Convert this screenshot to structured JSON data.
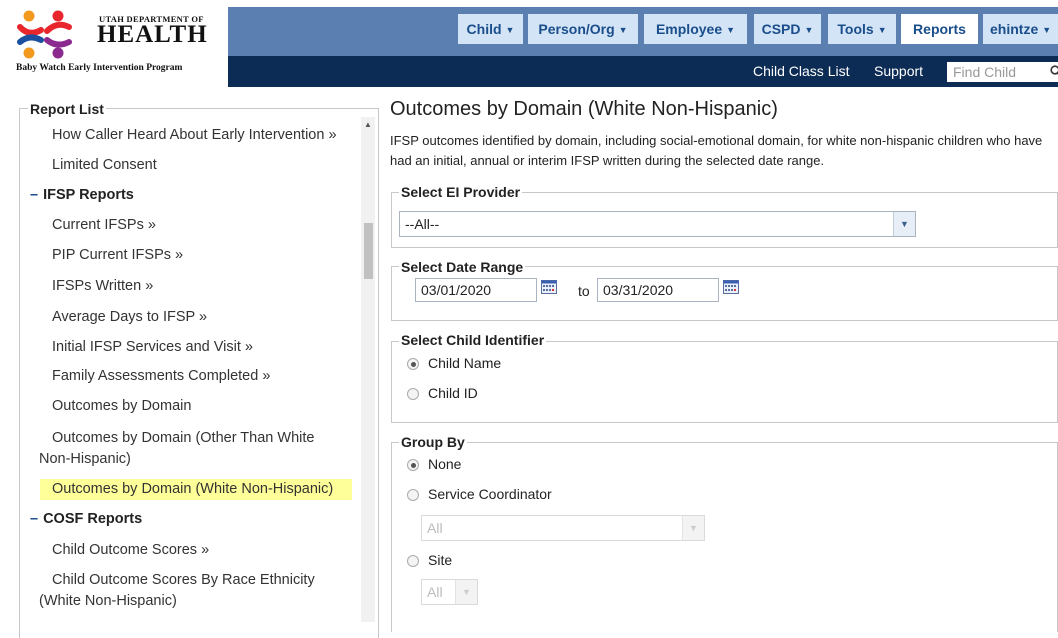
{
  "header": {
    "logo_small": "UTAH DEPARTMENT OF",
    "logo_big": "HEALTH",
    "program": "Baby Watch Early Intervention Program",
    "nav": [
      {
        "label": "Child",
        "has_menu": true
      },
      {
        "label": "Person/Org",
        "has_menu": true
      },
      {
        "label": "Employee",
        "has_menu": true
      },
      {
        "label": "CSPD",
        "has_menu": true
      },
      {
        "label": "Tools",
        "has_menu": true
      },
      {
        "label": "Reports",
        "has_menu": false,
        "active": true
      },
      {
        "label": "ehintze",
        "has_menu": true
      }
    ],
    "subnav": {
      "child_class_list": "Child Class List",
      "support": "Support",
      "find_child_placeholder": "Find Child"
    }
  },
  "report_list": {
    "title": "Report List",
    "items": [
      {
        "label": "How Caller Heard About Early Intervention »",
        "type": "item"
      },
      {
        "label": "Limited Consent",
        "type": "item"
      },
      {
        "label": "IFSP Reports",
        "type": "section"
      },
      {
        "label": "Current IFSPs »",
        "type": "item"
      },
      {
        "label": "PIP Current IFSPs »",
        "type": "item"
      },
      {
        "label": "IFSPs Written »",
        "type": "item"
      },
      {
        "label": "Average Days to IFSP »",
        "type": "item"
      },
      {
        "label": "Initial IFSP Services and Visit »",
        "type": "item"
      },
      {
        "label": "Family Assessments Completed »",
        "type": "item"
      },
      {
        "label": "Outcomes by Domain",
        "type": "item"
      },
      {
        "label_line1": "Outcomes by Domain (Other Than White",
        "label_line2": "Non-Hispanic)",
        "type": "item"
      },
      {
        "label": "Outcomes by Domain (White Non-Hispanic)",
        "type": "item",
        "selected": true
      },
      {
        "label": "COSF Reports",
        "type": "section"
      },
      {
        "label": "Child Outcome Scores »",
        "type": "item"
      },
      {
        "label_line1": "Child Outcome Scores By Race Ethnicity",
        "label_line2": "(White Non-Hispanic)",
        "type": "item"
      }
    ],
    "section_marker": "–"
  },
  "main": {
    "title": "Outcomes by Domain (White Non-Hispanic)",
    "description": "IFSP outcomes identified by domain, including social-emotional domain, for white non-hispanic children who have had an initial, annual or interim IFSP written during the selected date range.",
    "provider": {
      "legend": "Select EI Provider",
      "value": "--All--"
    },
    "date_range": {
      "legend": "Select Date Range",
      "from": "03/01/2020",
      "to_label": "to",
      "to": "03/31/2020"
    },
    "child_identifier": {
      "legend": "Select Child Identifier",
      "options": [
        {
          "label": "Child Name",
          "checked": true
        },
        {
          "label": "Child ID",
          "checked": false
        }
      ]
    },
    "group_by": {
      "legend": "Group By",
      "options": [
        {
          "label": "None",
          "checked": true
        },
        {
          "label": "Service Coordinator",
          "checked": false
        },
        {
          "label": "Site",
          "checked": false
        }
      ],
      "coordinator_select": "All",
      "site_select": "All"
    }
  },
  "colors": {
    "nav_bar": "#5b7fb0",
    "nav_button": "#d4e4f7",
    "subnav_bar": "#0d2c55",
    "selected_highlight": "#ffff99"
  }
}
